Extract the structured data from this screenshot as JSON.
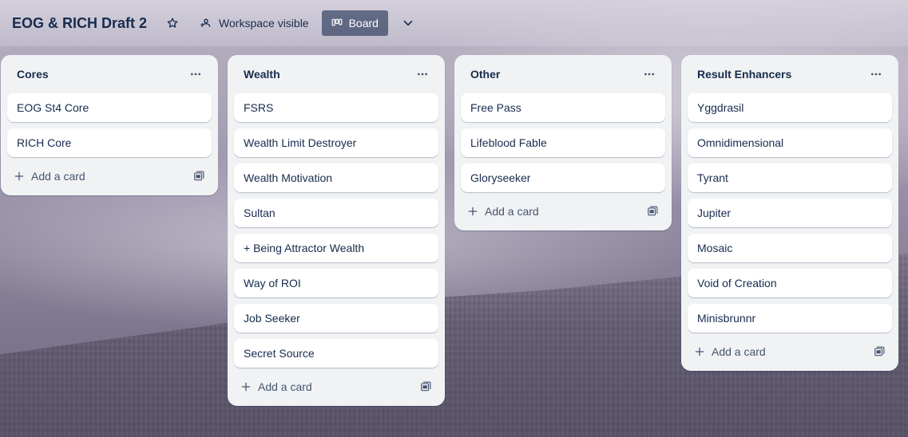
{
  "header": {
    "board_title": "EOG & RICH Draft 2",
    "visibility_label": "Workspace visible",
    "view_label": "Board"
  },
  "lists": [
    {
      "title": "Cores",
      "cards": [
        "EOG St4 Core",
        "RICH Core"
      ],
      "add_label": "Add a card"
    },
    {
      "title": "Wealth",
      "cards": [
        "FSRS",
        "Wealth Limit Destroyer",
        "Wealth Motivation",
        "Sultan",
        "+ Being Attractor Wealth",
        "Way of ROI",
        "Job Seeker",
        "Secret Source"
      ],
      "add_label": "Add a card"
    },
    {
      "title": "Other",
      "cards": [
        "Free Pass",
        "Lifeblood Fable",
        "Gloryseeker"
      ],
      "add_label": "Add a card"
    },
    {
      "title": "Result Enhancers",
      "cards": [
        "Yggdrasil",
        "Omnidimensional",
        "Tyrant",
        "Jupiter",
        "Mosaic",
        "Void of Creation",
        "Minisbrunnr"
      ],
      "add_label": "Add a card"
    }
  ],
  "icons": {
    "star": "star-icon",
    "visibility": "people-icon",
    "board": "board-icon",
    "view_switcher": "chevron-down-icon",
    "list_menu": "more-icon",
    "add": "plus-icon",
    "template": "template-icon"
  },
  "colors": {
    "list_bg": "#f1f2f4",
    "card_bg": "#ffffff",
    "text": "#172b4d",
    "active_view_bg": "#5b6070"
  }
}
